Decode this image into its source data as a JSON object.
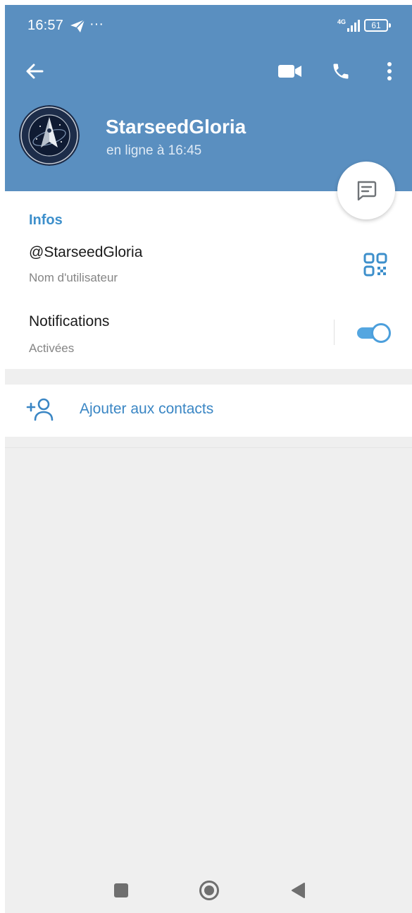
{
  "status_bar": {
    "time": "16:57",
    "dots": "···",
    "network": "4G",
    "battery": "61"
  },
  "profile": {
    "name": "StarseedGloria",
    "status": "en ligne à 16:45",
    "avatar_icon": "space-force-emblem-icon"
  },
  "toolbar": {
    "back_icon": "arrow-left-icon",
    "video_icon": "video-camera-icon",
    "call_icon": "phone-icon",
    "more_icon": "more-vertical-icon"
  },
  "info": {
    "section_title": "Infos",
    "username": "@StarseedGloria",
    "username_label": "Nom d'utilisateur",
    "notifications_title": "Notifications",
    "notifications_state": "Activées",
    "notifications_enabled": true
  },
  "actions": {
    "add_contact_label": "Ajouter aux contacts"
  },
  "colors": {
    "header_bg": "#5a8fc0",
    "accent": "#3d8fcb",
    "page_bg": "#efefef"
  }
}
